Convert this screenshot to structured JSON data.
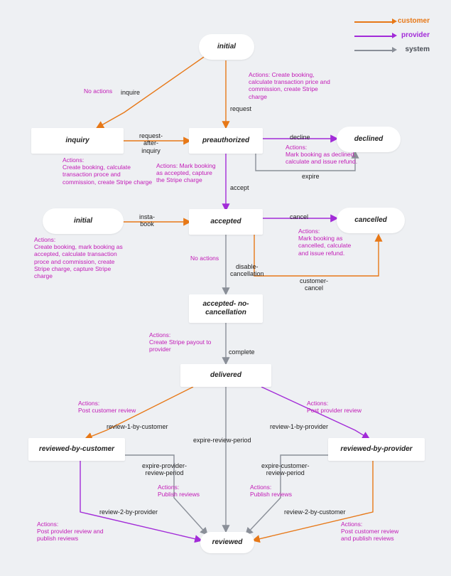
{
  "colors": {
    "customer": "#e77817",
    "provider": "#a22bd8",
    "system": "#8a8f98",
    "action": "#c21bb7"
  },
  "legend": {
    "customer": "customer",
    "provider": "provider",
    "system": "system"
  },
  "nodes": {
    "initial1": "initial",
    "inquiry": "inquiry",
    "preauthorized": "preauthorized",
    "declined": "declined",
    "initial2": "initial",
    "accepted": "accepted",
    "cancelled": "cancelled",
    "accepted_nc": "accepted-\nno-cancellation",
    "delivered": "delivered",
    "rbc": "reviewed-by-customer",
    "rbp": "reviewed-by-provider",
    "reviewed": "reviewed"
  },
  "edges": {
    "inquire": "inquire",
    "no_actions_1": "No actions",
    "request": "request",
    "request_after_inquiry": "request-\nafter-\ninquiry",
    "decline": "decline",
    "expire": "expire",
    "accept": "accept",
    "insta_book": "insta-\nbook",
    "cancel": "cancel",
    "customer_cancel": "customer-\ncancel",
    "no_actions_2": "No actions",
    "disable_cancellation": "disable-\ncancellation",
    "complete": "complete",
    "r1_by_customer": "review-1-by-customer",
    "r1_by_provider": "review-1-by-provider",
    "expire_review_period": "expire-review-period",
    "expire_provider_rp": "expire-provider-\nreview-period",
    "expire_customer_rp": "expire-customer-\nreview-period",
    "r2_by_provider": "review-2-by-provider",
    "r2_by_customer": "review-2-by-customer"
  },
  "actions": {
    "a_request": "Actions: Create booking,\ncalculate transaction price and\ncommission, create Stripe\ncharge",
    "a_req_after": "Actions:\nCreate booking, calculate\ntransaction proce and\ncommission, create Stripe charge",
    "a_accept": "Actions: Mark booking\nas accepted, capture\nthe Stripe charge",
    "a_decline": "Actions:\nMark booking as declined,\ncalculate and issue refund.",
    "a_instabook": "Actions:\nCreate booking, mark booking as\naccepted, calculate transaction\nproce and commission, create\nStripe charge, capture Stripe\ncharge",
    "a_cancel": "Actions:\nMark booking as\ncancelled, calculate\nand issue refund.",
    "a_complete": "Actions:\nCreate Stripe payout to\nprovider",
    "a_r1_cust": "Actions:\nPost customer review",
    "a_r1_prov": "Actions:\nPost provider review",
    "a_pub_c": "Actions:\nPublish reviews",
    "a_pub_p": "Actions:\nPublish reviews",
    "a_r2_prov": "Actions:\nPost provider review and\npublish reviews",
    "a_r2_cust": "Actions:\nPost customer review\nand publish reviews"
  },
  "chart_data": {
    "type": "state-diagram",
    "legend_colors": {
      "customer": "#e77817",
      "provider": "#a22bd8",
      "system": "#8a8f98"
    },
    "states": [
      {
        "id": "initial1",
        "label": "initial",
        "shape": "round"
      },
      {
        "id": "inquiry",
        "label": "inquiry",
        "shape": "rect"
      },
      {
        "id": "preauthorized",
        "label": "preauthorized",
        "shape": "rect"
      },
      {
        "id": "declined",
        "label": "declined",
        "shape": "round"
      },
      {
        "id": "initial2",
        "label": "initial",
        "shape": "round"
      },
      {
        "id": "accepted",
        "label": "accepted",
        "shape": "rect"
      },
      {
        "id": "cancelled",
        "label": "cancelled",
        "shape": "round"
      },
      {
        "id": "accepted_nc",
        "label": "accepted-no-cancellation",
        "shape": "rect"
      },
      {
        "id": "delivered",
        "label": "delivered",
        "shape": "rect"
      },
      {
        "id": "rbc",
        "label": "reviewed-by-customer",
        "shape": "rect"
      },
      {
        "id": "rbp",
        "label": "reviewed-by-provider",
        "shape": "rect"
      },
      {
        "id": "reviewed",
        "label": "reviewed",
        "shape": "round"
      }
    ],
    "transitions": [
      {
        "from": "initial1",
        "to": "inquiry",
        "label": "inquire",
        "actor": "customer",
        "note": "No actions"
      },
      {
        "from": "initial1",
        "to": "preauthorized",
        "label": "request",
        "actor": "customer",
        "actions": "Create booking, calculate transaction price and commission, create Stripe charge"
      },
      {
        "from": "inquiry",
        "to": "preauthorized",
        "label": "request-after-inquiry",
        "actor": "customer",
        "actions": "Create booking, calculate transaction proce and commission, create Stripe charge"
      },
      {
        "from": "preauthorized",
        "to": "declined",
        "label": "decline",
        "actor": "provider",
        "actions": "Mark booking as declined, calculate and issue refund."
      },
      {
        "from": "preauthorized",
        "to": "declined",
        "label": "expire",
        "actor": "system"
      },
      {
        "from": "preauthorized",
        "to": "accepted",
        "label": "accept",
        "actor": "provider",
        "actions": "Mark booking as accepted, capture the Stripe charge"
      },
      {
        "from": "initial2",
        "to": "accepted",
        "label": "insta-book",
        "actor": "customer",
        "actions": "Create booking, mark booking as accepted, calculate transaction proce and commission, create Stripe charge, capture Stripe charge"
      },
      {
        "from": "accepted",
        "to": "cancelled",
        "label": "cancel",
        "actor": "provider",
        "actions": "Mark booking as cancelled, calculate and issue refund."
      },
      {
        "from": "accepted",
        "to": "cancelled",
        "label": "customer-cancel",
        "actor": "customer"
      },
      {
        "from": "accepted",
        "to": "accepted_nc",
        "label": "disable-cancellation",
        "actor": "system",
        "note": "No actions"
      },
      {
        "from": "accepted_nc",
        "to": "delivered",
        "label": "complete",
        "actor": "system",
        "actions": "Create Stripe payout to provider"
      },
      {
        "from": "delivered",
        "to": "rbc",
        "label": "review-1-by-customer",
        "actor": "customer",
        "actions": "Post customer review"
      },
      {
        "from": "delivered",
        "to": "rbp",
        "label": "review-1-by-provider",
        "actor": "provider",
        "actions": "Post provider review"
      },
      {
        "from": "delivered",
        "to": "reviewed",
        "label": "expire-review-period",
        "actor": "system"
      },
      {
        "from": "rbc",
        "to": "reviewed",
        "label": "expire-provider-review-period",
        "actor": "system",
        "actions": "Publish reviews"
      },
      {
        "from": "rbp",
        "to": "reviewed",
        "label": "expire-customer-review-period",
        "actor": "system",
        "actions": "Publish reviews"
      },
      {
        "from": "rbc",
        "to": "reviewed",
        "label": "review-2-by-provider",
        "actor": "provider",
        "actions": "Post provider review and publish reviews"
      },
      {
        "from": "rbp",
        "to": "reviewed",
        "label": "review-2-by-customer",
        "actor": "customer",
        "actions": "Post customer review and publish reviews"
      }
    ]
  }
}
